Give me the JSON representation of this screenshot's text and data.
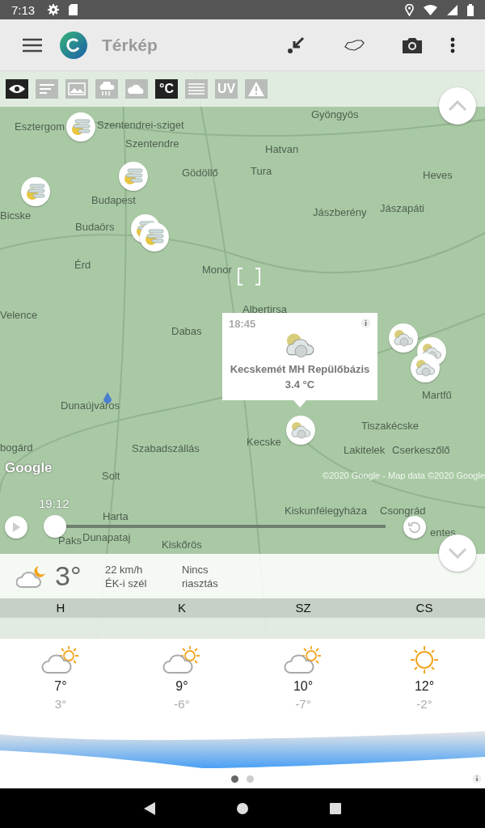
{
  "status_bar": {
    "time": "7:13"
  },
  "app_bar": {
    "title": "Térkép"
  },
  "layers": [
    {
      "kind": "eye",
      "selected": true
    },
    {
      "kind": "wind",
      "selected": false
    },
    {
      "kind": "image",
      "selected": false
    },
    {
      "kind": "rain",
      "selected": false
    },
    {
      "kind": "cloud",
      "selected": false
    },
    {
      "kind": "text",
      "label": "°C",
      "selected": true
    },
    {
      "kind": "lines",
      "selected": false
    },
    {
      "kind": "text",
      "label": "UV",
      "selected": false
    },
    {
      "kind": "warning",
      "selected": false
    }
  ],
  "map": {
    "places": [
      "Gyöngyös",
      "Esztergom",
      "Szentendrei-sziget",
      "Szentendre",
      "Hatvan",
      "Gödöllő",
      "Tura",
      "Heves",
      "Budapest",
      "Bicske",
      "Jászberény",
      "Jászapáti",
      "Budaörs",
      "Érd",
      "Monor",
      "Velence",
      "Albertirsa",
      "Dabas",
      "Dunaújváros",
      "Martfű",
      "Tiszakécske",
      "bogárd",
      "Szabadszállás",
      "Kecske",
      "Lakitelek",
      "Cserkeszőlő",
      "Solt",
      "Kiskunfélegyháza",
      "Csongrád",
      "Harta",
      "Paks",
      "Dunapataj",
      "Kiskőrös",
      "entes"
    ],
    "stations": [
      {
        "kind": "fog"
      },
      {
        "kind": "fog"
      },
      {
        "kind": "fog"
      },
      {
        "kind": "fog"
      },
      {
        "kind": "fog"
      },
      {
        "kind": "cloud"
      },
      {
        "kind": "cloud"
      },
      {
        "kind": "cloud"
      },
      {
        "kind": "cloud"
      }
    ],
    "popup": {
      "time": "18:45",
      "station": "Kecskemét MH Repülőbázis",
      "temperature": "3.4 °C"
    },
    "logo": "Google",
    "copyright": "©2020 Google - Map data ©2020 Google"
  },
  "timeline": {
    "time": "19:12",
    "level": 0
  },
  "current": {
    "temperature": "3°",
    "wind_speed": "22 km/h",
    "wind_direction": "ÉK-i szél",
    "alert": "Nincs",
    "alert_detail": "riasztás"
  },
  "forecast": [
    {
      "day": "H",
      "kind": "partly_cloudy",
      "high": "7°",
      "low": "3°"
    },
    {
      "day": "K",
      "kind": "partly_cloudy",
      "high": "9°",
      "low": "-6°"
    },
    {
      "day": "SZ",
      "kind": "partly_cloudy",
      "high": "10°",
      "low": "-7°"
    },
    {
      "day": "CS",
      "kind": "sunny",
      "high": "12°",
      "low": "-2°"
    }
  ],
  "pager": [
    {
      "selected": true
    },
    {
      "selected": false
    }
  ]
}
